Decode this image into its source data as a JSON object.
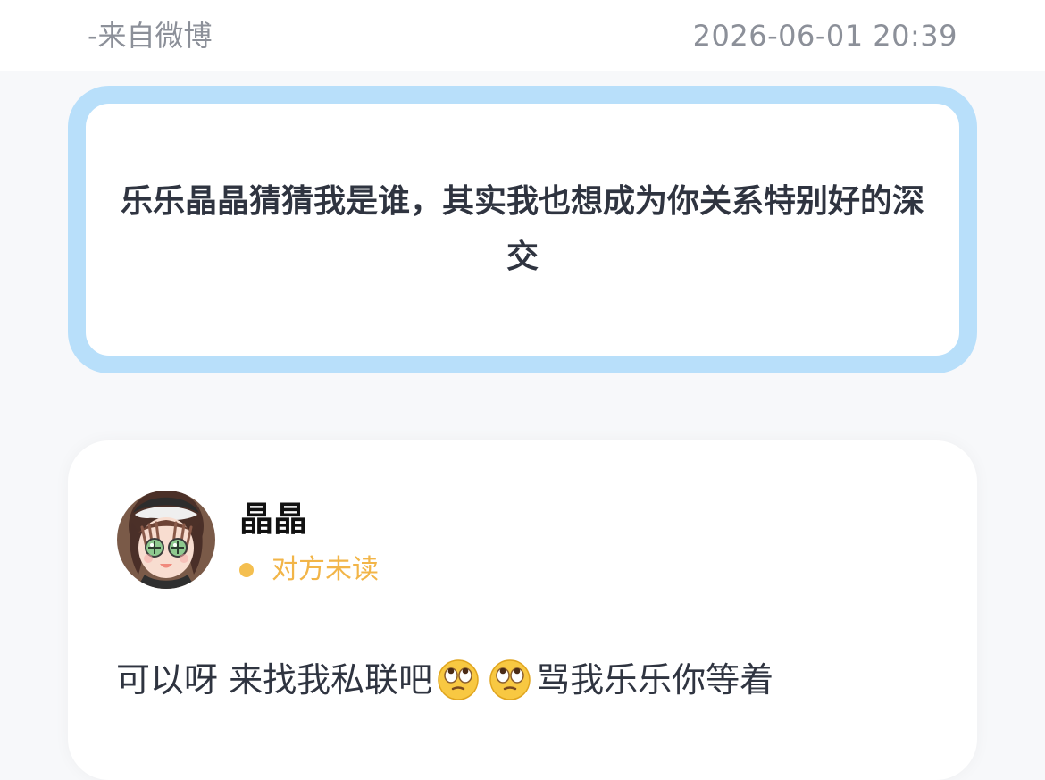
{
  "header": {
    "source": "-来自微博",
    "timestamp": "2026-06-01 20:39"
  },
  "message": {
    "text": "乐乐晶晶猜猜我是谁，其实我也想成为你关系特别好的深交"
  },
  "reply": {
    "user_name": "晶晶",
    "status": "对方未读",
    "text_before": "可以呀 来找我私联吧",
    "text_after": "骂我乐乐你等着",
    "emojis": [
      "eye-roll-emoji",
      "eye-roll-emoji"
    ]
  },
  "colors": {
    "card_border": "#b8dffa",
    "status_color": "#f2b548",
    "muted_text": "#8c9099"
  }
}
